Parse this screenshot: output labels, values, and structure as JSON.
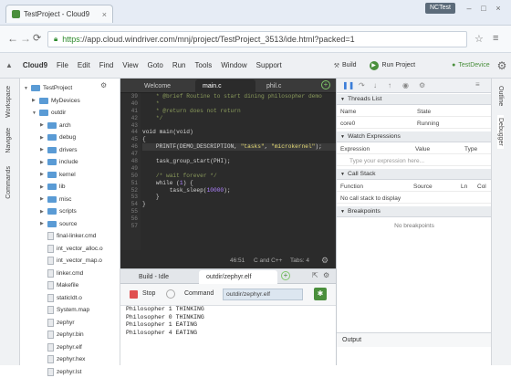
{
  "browser": {
    "tab_title": "TestProject - Cloud9",
    "url_https": "https",
    "url_rest": "://app.cloud.windriver.com/mnj/project/TestProject_3513/ide.html?packed=1",
    "user_badge": "NCTest",
    "nav_icons": [
      "back-icon",
      "forward-icon",
      "reload-icon"
    ]
  },
  "menu": {
    "brand": "Cloud9",
    "items": [
      "File",
      "Edit",
      "Find",
      "View",
      "Goto",
      "Run",
      "Tools",
      "Window",
      "Support"
    ],
    "build": "Build",
    "run_project": "Run Project",
    "device": "TestDevice"
  },
  "leftstrip": {
    "workspace": "Workspace",
    "navigate": "Navigate",
    "commands": "Commands"
  },
  "tree": [
    {
      "name": "TestProject",
      "type": "folder",
      "level": 0,
      "open": true
    },
    {
      "name": "MyDevices",
      "type": "folder",
      "level": 1,
      "open": false
    },
    {
      "name": "outdir",
      "type": "folder",
      "level": 1,
      "open": true
    },
    {
      "name": "arch",
      "type": "folder",
      "level": 2,
      "open": false
    },
    {
      "name": "debug",
      "type": "folder",
      "level": 2,
      "open": false
    },
    {
      "name": "drivers",
      "type": "folder",
      "level": 2,
      "open": false
    },
    {
      "name": "include",
      "type": "folder",
      "level": 2,
      "open": false
    },
    {
      "name": "kernel",
      "type": "folder",
      "level": 2,
      "open": false
    },
    {
      "name": "lib",
      "type": "folder",
      "level": 2,
      "open": false
    },
    {
      "name": "misc",
      "type": "folder",
      "level": 2,
      "open": false
    },
    {
      "name": "scripts",
      "type": "folder",
      "level": 2,
      "open": false
    },
    {
      "name": "source",
      "type": "folder",
      "level": 2,
      "open": false
    },
    {
      "name": "final-linker.cmd",
      "type": "file",
      "level": 2
    },
    {
      "name": "int_vector_alloc.o",
      "type": "file",
      "level": 2
    },
    {
      "name": "int_vector_map.o",
      "type": "file",
      "level": 2
    },
    {
      "name": "linker.cmd",
      "type": "file",
      "level": 2
    },
    {
      "name": "Makefile",
      "type": "file",
      "level": 2
    },
    {
      "name": "staticIdt.o",
      "type": "file",
      "level": 2
    },
    {
      "name": "System.map",
      "type": "file",
      "level": 2
    },
    {
      "name": "zephyr",
      "type": "file",
      "level": 2
    },
    {
      "name": "zephyr.bin",
      "type": "file",
      "level": 2
    },
    {
      "name": "zephyr.elf",
      "type": "file",
      "level": 2
    },
    {
      "name": "zephyr.hex",
      "type": "file",
      "level": 2
    },
    {
      "name": "zephyr.lst",
      "type": "file",
      "level": 2
    }
  ],
  "editor": {
    "tabs": [
      "Welcome",
      "main.c",
      "phil.c"
    ],
    "active_tab": 1,
    "line_numbers": [
      "39",
      "40",
      "41",
      "42",
      "43",
      "44",
      "45",
      "46",
      "47",
      "48",
      "49",
      "50",
      "51",
      "52",
      "53",
      "54",
      "55",
      "56",
      "57"
    ],
    "lines": [
      [
        {
          "t": "    * @brief Routine to start dining philosopher demo",
          "c": "#8a9a5b"
        }
      ],
      [
        {
          "t": "    *",
          "c": "#8a9a5b"
        }
      ],
      [
        {
          "t": "    * @return does not return",
          "c": "#8a9a5b"
        }
      ],
      [
        {
          "t": "    */",
          "c": "#8a9a5b"
        }
      ],
      [
        {
          "t": "",
          "c": "#d4d4d4"
        }
      ],
      [
        {
          "t": "void",
          "c": "#d4d4d4"
        },
        {
          "t": " main",
          "c": "#d4d4d4"
        },
        {
          "t": "(",
          "c": "#d4d4d4"
        },
        {
          "t": "void",
          "c": "#d4d4d4"
        },
        {
          "t": ")",
          "c": "#d4d4d4"
        }
      ],
      [
        {
          "t": "{",
          "c": "#d4d4d4"
        }
      ],
      [
        {
          "t": "    PRINTF(DEMO_DESCRIPTION, ",
          "c": "#d4d4d4"
        },
        {
          "t": "\"tasks\"",
          "c": "#e6db74"
        },
        {
          "t": ", ",
          "c": "#d4d4d4"
        },
        {
          "t": "\"microkernel\"",
          "c": "#e6db74"
        },
        {
          "t": ");",
          "c": "#d4d4d4"
        }
      ],
      [
        {
          "t": "",
          "c": "#d4d4d4"
        }
      ],
      [
        {
          "t": "    task_group_start(PHI);",
          "c": "#d4d4d4"
        }
      ],
      [
        {
          "t": "",
          "c": "#d4d4d4"
        }
      ],
      [
        {
          "t": "    /* wait forever */",
          "c": "#8a9a5b"
        }
      ],
      [
        {
          "t": "    while",
          "c": "#d4d4d4"
        },
        {
          "t": " (",
          "c": "#d4d4d4"
        },
        {
          "t": "1",
          "c": "#ae81ff"
        },
        {
          "t": ") {",
          "c": "#d4d4d4"
        }
      ],
      [
        {
          "t": "        task_sleep(",
          "c": "#d4d4d4"
        },
        {
          "t": "10000",
          "c": "#ae81ff"
        },
        {
          "t": ");",
          "c": "#d4d4d4"
        }
      ],
      [
        {
          "t": "    }",
          "c": "#d4d4d4"
        }
      ],
      [
        {
          "t": "}",
          "c": "#d4d4d4"
        }
      ],
      [
        {
          "t": "",
          "c": "#d4d4d4"
        }
      ],
      [
        {
          "t": "",
          "c": "#d4d4d4"
        }
      ],
      [
        {
          "t": "",
          "c": "#d4d4d4"
        }
      ]
    ],
    "highlight_line_index": 7,
    "status": {
      "cursor": "46:51",
      "lang": "C and C++",
      "tab": "Tabs: 4"
    }
  },
  "bottom": {
    "tabs": [
      "Build - Idle",
      "outdir/zephyr.elf"
    ],
    "active_tab": 1,
    "stop": "Stop",
    "command_label": "Command",
    "command_value": "outdir/zephyr.elf",
    "output": [
      "Philosopher 1 THINKING",
      "Philosopher 0 THINKING",
      "Philosopher 1 EATING",
      "Philosopher 4 EATING"
    ]
  },
  "debug": {
    "threads": {
      "title": "Threads List",
      "col1": "Name",
      "col2": "State",
      "row_name": "core0",
      "row_state": "Running"
    },
    "watch": {
      "title": "Watch Expressions",
      "col1": "Expression",
      "col2": "Value",
      "col3": "Type",
      "placeholder": "Type your expression here..."
    },
    "callstack": {
      "title": "Call Stack",
      "col1": "Function",
      "col2": "Source",
      "col3": "Ln",
      "col4": "Col",
      "empty": "No call stack to display"
    },
    "breakpoints": {
      "title": "Breakpoints",
      "empty": "No breakpoints"
    },
    "output_label": "Output"
  },
  "rightstrip": {
    "outline": "Outline",
    "debugger": "Debugger"
  },
  "colors": {
    "accent": "#4a8f3c",
    "tree_folder": "#5a9bd5",
    "editor_bg": "#2b2b2b",
    "stop_red": "#e05050"
  }
}
